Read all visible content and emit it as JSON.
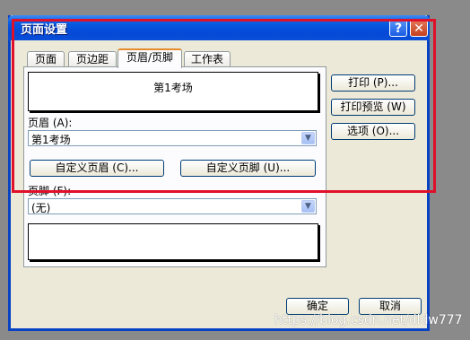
{
  "window": {
    "title": "页面设置",
    "help_label": "?",
    "close_label": "✕"
  },
  "tabs": [
    {
      "label": "页面"
    },
    {
      "label": "页边距"
    },
    {
      "label": "页眉/页脚"
    },
    {
      "label": "工作表"
    }
  ],
  "header_preview": {
    "text": "第1考场"
  },
  "header": {
    "label": "页眉 (A):",
    "value": "第1考场"
  },
  "custom_header_button": "自定义页眉 (C)...",
  "custom_footer_button": "自定义页脚 (U)...",
  "footer": {
    "label": "页脚 (F):",
    "value": "(无)"
  },
  "side_buttons": {
    "print": "打印 (P)...",
    "print_preview": "打印预览 (W)",
    "options": "选项 (O)..."
  },
  "bottom_buttons": {
    "ok": "确定",
    "cancel": "取消"
  },
  "watermark": "https://blog.csdn.net/dldw777",
  "colors": {
    "annotation": "#e0102a",
    "titlebar": "#0a5ce1"
  },
  "icons": {
    "dropdown": "chevron-down-icon"
  }
}
